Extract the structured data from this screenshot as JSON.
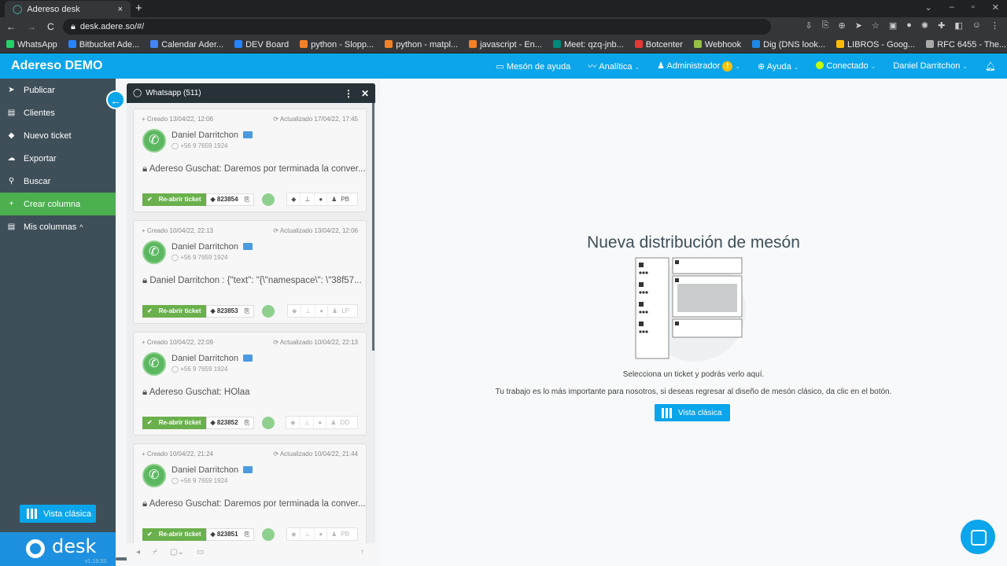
{
  "browser": {
    "tab_title": "Adereso desk",
    "url": "desk.adere.so/#/",
    "bookmarks": [
      {
        "label": "WhatsApp",
        "color": "#25d366"
      },
      {
        "label": "Bitbucket Ade...",
        "color": "#2684ff"
      },
      {
        "label": "Calendar Ader...",
        "color": "#4285f4"
      },
      {
        "label": "DEV Board",
        "color": "#2684ff"
      },
      {
        "label": "python - Slopp...",
        "color": "#f48024"
      },
      {
        "label": "python - matpl...",
        "color": "#f48024"
      },
      {
        "label": "javascript - En...",
        "color": "#f48024"
      },
      {
        "label": "Meet: qzq-jnb...",
        "color": "#00897b"
      },
      {
        "label": "Botcenter",
        "color": "#e53935"
      },
      {
        "label": "Webhook",
        "color": "#95bf47"
      },
      {
        "label": "Dig (DNS look...",
        "color": "#1e88e5"
      },
      {
        "label": "LIBROS - Goog...",
        "color": "#fbbc04"
      },
      {
        "label": "RFC 6455 - The...",
        "color": "#aaaaaa"
      }
    ]
  },
  "app": {
    "brand": "Adereso DEMO",
    "nav": [
      {
        "label": "Mesón de ayuda",
        "icon": "monitor-icon"
      },
      {
        "label": "Analítica",
        "icon": "chart-icon"
      },
      {
        "label": "Administrador",
        "icon": "admin-icon",
        "badge": "!"
      },
      {
        "label": "Ayuda",
        "icon": "globe-icon"
      },
      {
        "label": "Conectado",
        "icon": "status-dot"
      },
      {
        "label": "Daniel Darritchon"
      }
    ]
  },
  "sidebar": {
    "items": [
      {
        "label": "Publicar",
        "icon": "➤"
      },
      {
        "label": "Clientes",
        "icon": "▤"
      },
      {
        "label": "Nuevo ticket",
        "icon": "◆"
      },
      {
        "label": "Exportar",
        "icon": "☁"
      },
      {
        "label": "Buscar",
        "icon": "⚲"
      },
      {
        "label": "Crear columna",
        "icon": "+",
        "active": true
      },
      {
        "label": "Mis columnas",
        "icon": "▤",
        "caret": "^"
      }
    ],
    "classic_button": "Vista clásica",
    "logo": "desk",
    "version": "v1.19.53"
  },
  "column": {
    "title": "Whatsapp (511)",
    "cards": [
      {
        "created": "Creado  13/04/22, 12:06",
        "updated": "Actualizado  17/04/22, 17:45",
        "name": "Daniel Darritchon",
        "phone": "+56 9 7659 1924",
        "message": "Adereso Guschat: Daremos por terminada la conver...",
        "reopen": "Re-abrir ticket",
        "id": "823854",
        "agent": "PB",
        "faded": false
      },
      {
        "created": "Creado  10/04/22, 22:13",
        "updated": "Actualizado  13/04/22, 12:06",
        "name": "Daniel Darritchon",
        "phone": "+56 9 7659 1924",
        "message": "Daniel Darritchon : {\"text\": \"{\\\"namespace\\\": \\\"38f57...",
        "reopen": "Re-abrir ticket",
        "id": "823853",
        "agent": "LP",
        "faded": true
      },
      {
        "created": "Creado  10/04/22, 22:09",
        "updated": "Actualizado  10/04/22, 22:13",
        "name": "Daniel Darritchon",
        "phone": "+56 9 7659 1924",
        "message": "Adereso Guschat: HOlaa",
        "reopen": "Re-abrir ticket",
        "id": "823852",
        "agent": "DD",
        "faded": true
      },
      {
        "created": "Creado  10/04/22, 21:24",
        "updated": "Actualizado  10/04/22, 21:44",
        "name": "Daniel Darritchon",
        "phone": "+56 9 7659 1924",
        "message": "Adereso Guschat: Daremos por terminada la conver...",
        "reopen": "Re-abrir ticket",
        "id": "823851",
        "agent": "PB",
        "faded": true
      }
    ]
  },
  "main": {
    "title": "Nueva distribución de mesón",
    "line1": "Selecciona un ticket y podrás verlo aquí.",
    "line2": "Tu trabajo es lo más importante para nosotros, si deseas regresar al diseño de mesón clásico, da clic en el botón.",
    "button": "Vista clásica"
  }
}
